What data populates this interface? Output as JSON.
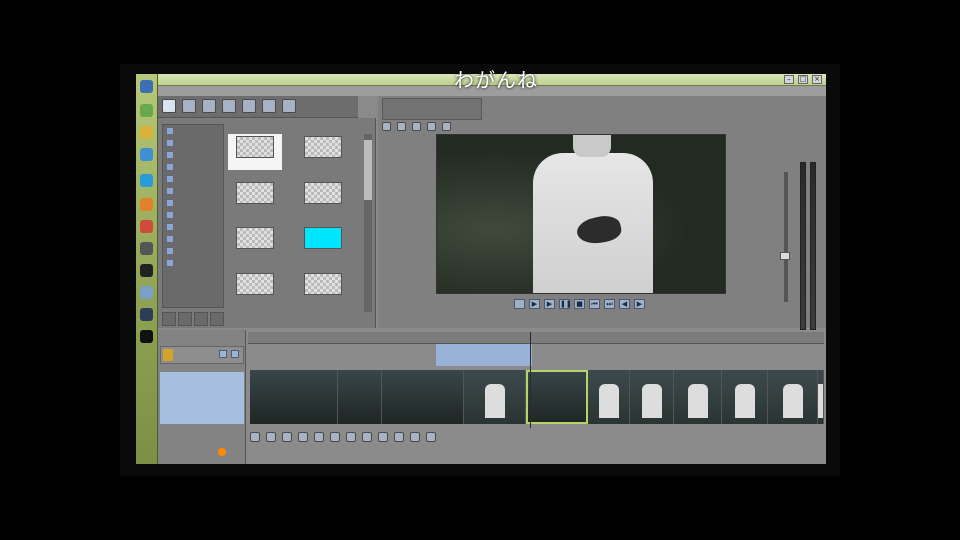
{
  "overlay_caption": "わがんね",
  "colors": {
    "taskbar": "#8ea152",
    "titlebar": "#bdd08f",
    "selected_track": "#a6bedf",
    "loop_region": "#9ab6e0",
    "clip_selection": "#b6d36a",
    "record_indicator": "#ff8a00",
    "highlight_thumbnail": "#00e5ff"
  },
  "taskbar_icons": [
    "media-player-icon",
    "folder-icon",
    "chrome-icon",
    "browser-icon",
    "skype-icon",
    "orange-app-icon",
    "red-app-icon",
    "tool-icon",
    "globe-icon",
    "app-icon",
    "steam-icon",
    "dark-app-icon"
  ],
  "media_panel": {
    "thumbnails": [
      {
        "selected": true,
        "highlight": false
      },
      {
        "selected": false,
        "highlight": false
      },
      {
        "selected": false,
        "highlight": false
      },
      {
        "selected": false,
        "highlight": false
      },
      {
        "selected": false,
        "highlight": false
      },
      {
        "selected": false,
        "highlight": true
      },
      {
        "selected": false,
        "highlight": false
      },
      {
        "selected": false,
        "highlight": false
      }
    ]
  },
  "timeline": {
    "clips": [
      "dark",
      "dark",
      "dark",
      "person",
      "dark-selected",
      "person",
      "person",
      "person",
      "person",
      "person",
      "person"
    ]
  }
}
